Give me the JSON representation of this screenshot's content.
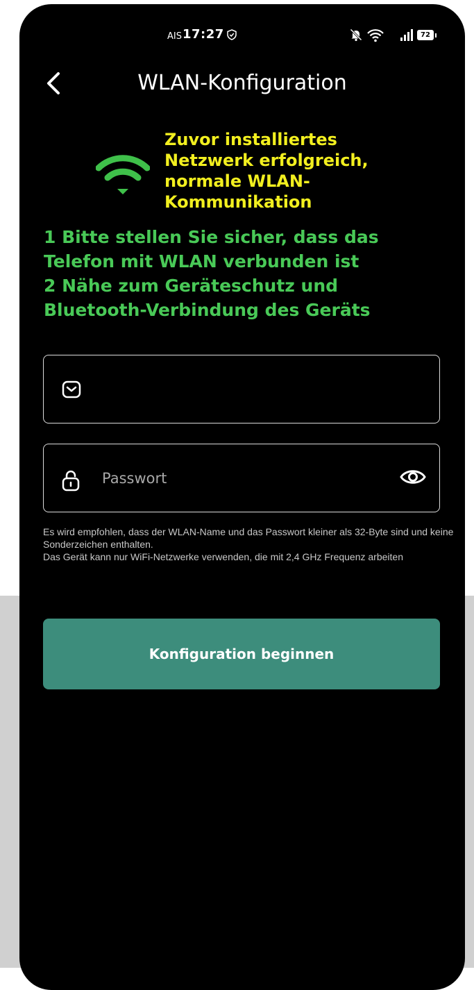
{
  "status_bar": {
    "carrier": "AIS",
    "time": "17:27",
    "battery": "72"
  },
  "header": {
    "title": "WLAN-Konfiguration"
  },
  "notice": {
    "network_success": "Zuvor installiertes\nNetzwerk erfolgreich,\nnormale WLAN-\nKommunikation",
    "instructions": "1 Bitte stellen Sie sicher, dass das\nTelefon mit WLAN verbunden ist\n2 Nähe zum Geräteschutz und\nBluetooth-Verbindung des Geräts"
  },
  "form": {
    "wlan_name": {
      "value": "",
      "placeholder": ""
    },
    "password": {
      "value": "",
      "placeholder": "Passwort"
    },
    "hint_line1": "Es wird empfohlen, dass der WLAN-Name und das Passwort kleiner als 32-Byte sind und keine Sonderzeichen enthalten.",
    "hint_line2": "Das Gerät kann nur WiFi-Netzwerke verwenden, die mit 2,4 GHz Frequenz arbeiten",
    "submit_label": "Konfiguration beginnen"
  },
  "colors": {
    "success_yellow": "#f2ef1f",
    "instruction_green": "#49c957",
    "wifi_icon_green": "#3fc04a",
    "button_teal": "#3d8d7c"
  },
  "icons": {
    "back": "chevron-left-icon",
    "wifi": "wifi-icon",
    "wlan_field": "mail-icon",
    "password_field": "lock-icon",
    "visibility": "eye-icon"
  }
}
